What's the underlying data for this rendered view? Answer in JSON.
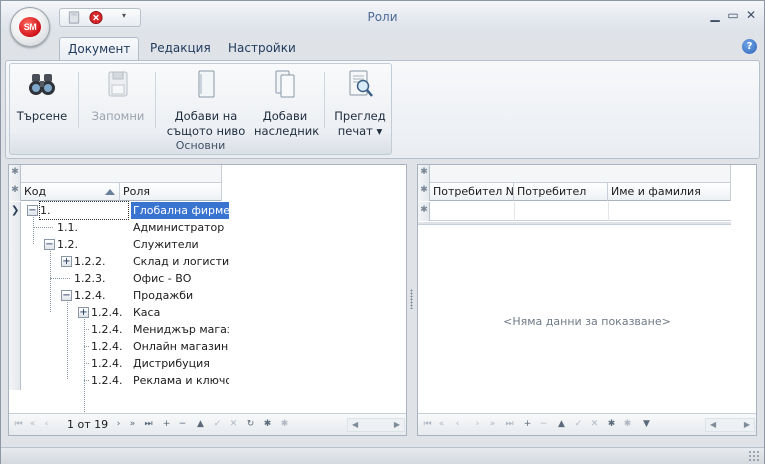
{
  "window": {
    "title": "Роли",
    "min_glyph": "▁",
    "max_glyph": "▭",
    "close_glyph": "✕"
  },
  "app_orb": {
    "text": "SM"
  },
  "qat": {
    "more_glyph": "▾"
  },
  "tabs": [
    {
      "label": "Документ",
      "active": true
    },
    {
      "label": "Редакция",
      "active": false
    },
    {
      "label": "Настройки",
      "active": false
    }
  ],
  "help": {
    "glyph": "?"
  },
  "ribbon": {
    "group_label": "Основни",
    "buttons": [
      {
        "label": "Търсене",
        "icon": "binoculars-icon",
        "enabled": true
      },
      {
        "label": "Запомни",
        "icon": "save-icon",
        "enabled": false
      },
      {
        "label": "Добави на\nсъщото ниво",
        "line1": "Добави на",
        "line2": "същото ниво",
        "icon": "add-sibling-icon",
        "enabled": true
      },
      {
        "label": "Добави\nнаследник",
        "line1": "Добави",
        "line2": "наследник",
        "icon": "add-child-icon",
        "enabled": true
      },
      {
        "label": "Преглед\nпечат",
        "line1": "Преглед",
        "line2": "печат ▾",
        "icon": "print-preview-icon",
        "enabled": true
      }
    ]
  },
  "left_grid": {
    "columns": {
      "code": "Код",
      "role": "Роля"
    },
    "rows": [
      {
        "code": "1.",
        "role": "Глобална фирмена",
        "expander": "−",
        "selected": true
      },
      {
        "code": "1.1.",
        "role": "Администратор",
        "expander": ""
      },
      {
        "code": "1.2.",
        "role": "Служители",
        "expander": "−"
      },
      {
        "code": "1.2.2.",
        "role": "Склад и логистика",
        "expander": "+"
      },
      {
        "code": "1.2.3.",
        "role": "Офис - ВО",
        "expander": ""
      },
      {
        "code": "1.2.4.",
        "role": "Продажби",
        "expander": "−"
      },
      {
        "code": "1.2.4.",
        "role": "Каса",
        "expander": "+"
      },
      {
        "code": "1.2.4.",
        "role": "Мениджър магазин",
        "expander": ""
      },
      {
        "code": "1.2.4.",
        "role": "Онлайн магазин",
        "expander": ""
      },
      {
        "code": "1.2.4.",
        "role": "Дистрибуция",
        "expander": ""
      },
      {
        "code": "1.2.4.",
        "role": "Реклама и ключови",
        "expander": ""
      }
    ],
    "pager": {
      "text": "1 от 19"
    }
  },
  "right_grid": {
    "columns": {
      "user_no": "Потребител №",
      "user": "Потребител",
      "full_name": "Име и фамилия"
    },
    "empty_message": "<Няма данни за показване>"
  },
  "nav_glyphs": {
    "first": "⏮",
    "prev_page": "«",
    "prev": "‹",
    "next": "›",
    "next_page": "»",
    "last": "⏭",
    "add": "+",
    "remove": "−",
    "up": "▲",
    "ok": "✓",
    "cancel": "✕",
    "refresh": "↻",
    "star": "✱",
    "filter": "▼"
  },
  "colors": {
    "selection": "#3a74d1",
    "title_text": "#4a6a95",
    "orb_red": "#d0121a"
  }
}
